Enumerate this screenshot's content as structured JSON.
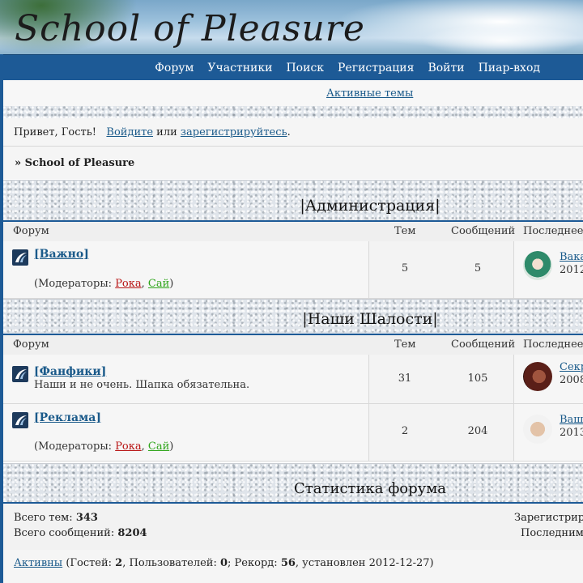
{
  "header": {
    "site_title": "School of Pleasure"
  },
  "nav": {
    "items": [
      "Форум",
      "Участники",
      "Поиск",
      "Регистрация",
      "Войти",
      "Пиар-вход"
    ]
  },
  "active_topics": "Активные темы",
  "welcome": {
    "greeting": "Привет, Гость!",
    "login": "Войдите",
    "or": "или",
    "register": "зарегистрируйтесь",
    "end": "."
  },
  "breadcrumb": "» School of Pleasure",
  "columns": {
    "forum": "Форум",
    "topics": "Тем",
    "posts": "Сообщений",
    "last": "Последнее с"
  },
  "categories": [
    {
      "title": "|Администрация|",
      "forums": [
        {
          "name": "[Важно]",
          "desc": "",
          "moderators_label": "(Модераторы:",
          "mod1": "Рока",
          "sep": ",",
          "mod2": "Сай",
          "close": ")",
          "topics": "5",
          "posts": "5",
          "last_link": "Вака",
          "last_date": "2012"
        }
      ]
    },
    {
      "title": "|Наши Шалости|",
      "forums": [
        {
          "name": "[Фанфики]",
          "desc": "Наши и не очень. Шапка обязательна.",
          "topics": "31",
          "posts": "105",
          "last_link": "Секр",
          "last_date": "2008"
        },
        {
          "name": "[Реклама]",
          "desc": "",
          "moderators_label": "(Модераторы:",
          "mod1": "Рока",
          "sep": ",",
          "mod2": "Сай",
          "close": ")",
          "topics": "2",
          "posts": "204",
          "last_link": "Ваш",
          "last_date": "2013"
        }
      ]
    }
  ],
  "stats": {
    "title": "Статистика форума",
    "total_topics_label": "Всего тем:",
    "total_topics": "343",
    "total_posts_label": "Всего сообщений:",
    "total_posts": "8204",
    "registered_label": "Зарегистриро",
    "last_label": "Последним з"
  },
  "online": {
    "active": "Активны",
    "guests_label": "(Гостей:",
    "guests": "2",
    "users_label": ", Пользователей:",
    "users": "0",
    "record_label": "; Рекорд:",
    "record": "56",
    "set_on": ", установлен 2012-12-27)"
  }
}
